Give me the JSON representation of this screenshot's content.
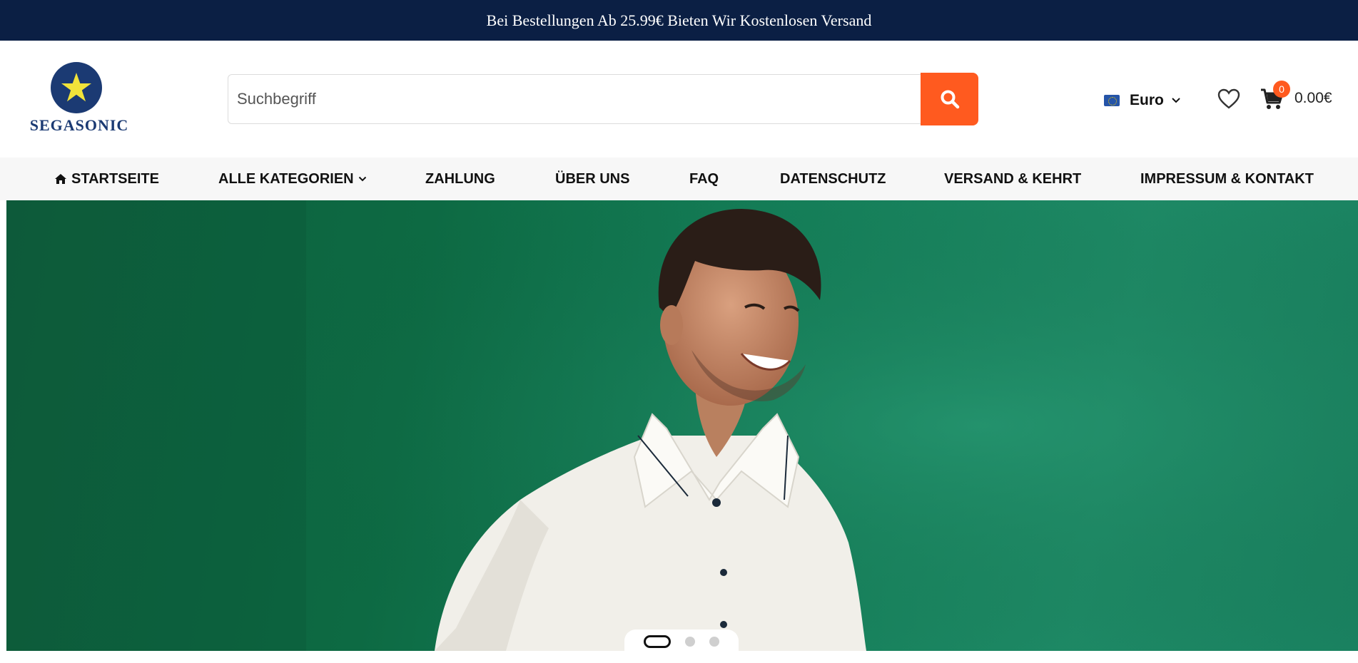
{
  "announcement": {
    "text": "Bei Bestellungen Ab 25.99€ Bieten Wir Kostenlosen Versand"
  },
  "brand": {
    "name": "SEGASONIC",
    "icon": "star-logo-icon"
  },
  "search": {
    "placeholder": "Suchbegriff",
    "button_icon": "search-icon"
  },
  "currency": {
    "label": "Euro",
    "icon": "eu-flag-icon"
  },
  "wishlist": {
    "icon": "heart-icon"
  },
  "cart": {
    "count": "0",
    "total": "0.00€",
    "icon": "cart-icon"
  },
  "nav": {
    "items": [
      {
        "label": "STARTSEITE",
        "icon": "home-icon"
      },
      {
        "label": "ALLE KATEGORIEN",
        "icon": "chevron-down-icon"
      },
      {
        "label": "ZAHLUNG"
      },
      {
        "label": "ÜBER UNS"
      },
      {
        "label": "FAQ"
      },
      {
        "label": "DATENSCHUTZ"
      },
      {
        "label": "VERSAND & KEHRT"
      },
      {
        "label": "IMPRESSUM & KONTAKT"
      }
    ]
  },
  "slider": {
    "slide_count": 3,
    "active_index": 0
  },
  "colors": {
    "topbar": "#0b1f44",
    "accent": "#ff5a1f",
    "brand": "#1b3a73",
    "hero_bg": "#15805a"
  }
}
